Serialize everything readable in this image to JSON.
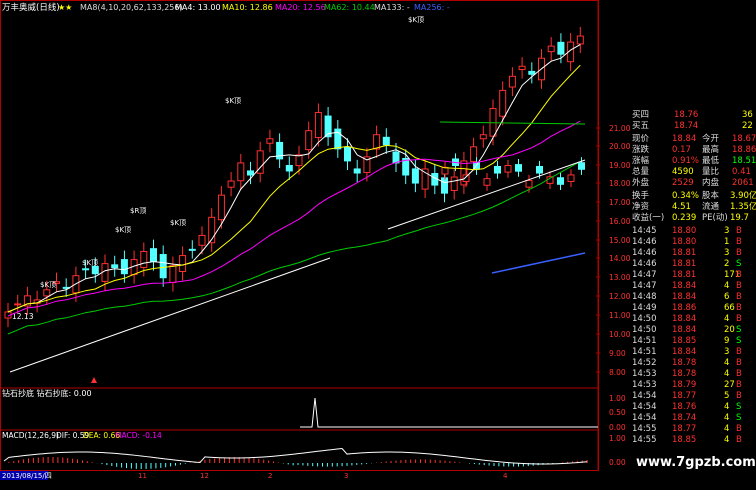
{
  "header": {
    "title": "万丰奥威(日线)",
    "stars": "★★",
    "ma_title": "MA8(4,10,20,62,133,256)",
    "ma4": "MA4: 13.00",
    "ma10": "MA10: 12.86",
    "ma20": "MA20: 12.56",
    "ma62": "MA62: 10.44",
    "ma133": "MA133: -",
    "ma256": "MA256: -"
  },
  "indicator_title": "钻石抄底 钻石抄底: 0.00",
  "macd_title": {
    "name": "MACD(12,26,9)",
    "dif": "DIF: 0.59",
    "dea": "DEA: 0.66",
    "macd": "MACD: -0.14"
  },
  "price_axis": [
    "21.00",
    "20.00",
    "19.00",
    "18.00",
    "17.00",
    "16.00",
    "15.00",
    "14.00",
    "13.00",
    "12.00",
    "11.00",
    "10.00",
    "9.00",
    "8.00"
  ],
  "ind_axis": [
    "1.00",
    "0.50",
    "0.00"
  ],
  "macd_axis": [
    "1.00",
    "0.00"
  ],
  "low_label": "12.13",
  "marks": [
    "$K顶",
    "$R顶",
    "$K顶",
    "$K顶",
    "$K顶",
    "$K顶",
    "$K顶"
  ],
  "date_label": "2013/08/15/四",
  "xlabels": [
    "11",
    "12",
    "2",
    "3",
    "4"
  ],
  "quote": {
    "rows": [
      {
        "l": "买四",
        "v": "18.76",
        "v2": "36",
        "c": "#ff3030"
      },
      {
        "l": "买五",
        "v": "18.74",
        "v2": "22",
        "c": "#ff3030"
      }
    ],
    "stats": [
      {
        "l": "现价",
        "v": "18.84",
        "l2": "今开",
        "v2": "18.67"
      },
      {
        "l": "涨跌",
        "v": "0.17",
        "l2": "最高",
        "v2": "18.86"
      },
      {
        "l": "涨幅",
        "v": "0.91%",
        "l2": "最低",
        "v2": "18.51"
      },
      {
        "l": "总量",
        "v": "4590",
        "l2": "量比",
        "v2": "0.41"
      },
      {
        "l": "外盘",
        "v": "2529",
        "l2": "内盘",
        "v2": "2061"
      }
    ],
    "stats2": [
      {
        "l": "换手",
        "v": "0.34%",
        "l2": "股本",
        "v2": "3.90亿"
      },
      {
        "l": "净资",
        "v": "4.51",
        "l2": "流通",
        "v2": "1.35亿"
      },
      {
        "l": "收益(一)",
        "v": "0.239",
        "l2": "PE(动)",
        "v2": "19.7"
      }
    ],
    "ticks": [
      {
        "t": "14:45",
        "p": "18.80",
        "q": "3",
        "d": "B"
      },
      {
        "t": "14:46",
        "p": "18.80",
        "q": "1",
        "d": "B"
      },
      {
        "t": "14:46",
        "p": "18.81",
        "q": "3",
        "d": "B"
      },
      {
        "t": "14:46",
        "p": "18.81",
        "q": "2",
        "d": "S"
      },
      {
        "t": "14:47",
        "p": "18.81",
        "q": "171",
        "d": "B"
      },
      {
        "t": "14:47",
        "p": "18.84",
        "q": "4",
        "d": "B"
      },
      {
        "t": "14:48",
        "p": "18.84",
        "q": "6",
        "d": "B"
      },
      {
        "t": "14:49",
        "p": "18.86",
        "q": "66",
        "d": "B"
      },
      {
        "t": "14:50",
        "p": "18.84",
        "q": "4",
        "d": "B"
      },
      {
        "t": "14:50",
        "p": "18.84",
        "q": "20",
        "d": "S"
      },
      {
        "t": "14:51",
        "p": "18.85",
        "q": "9",
        "d": "S"
      },
      {
        "t": "14:51",
        "p": "18.84",
        "q": "3",
        "d": "B"
      },
      {
        "t": "14:52",
        "p": "18.78",
        "q": "4",
        "d": "B"
      },
      {
        "t": "14:53",
        "p": "18.78",
        "q": "4",
        "d": "B"
      },
      {
        "t": "14:53",
        "p": "18.79",
        "q": "27",
        "d": "B"
      },
      {
        "t": "14:54",
        "p": "18.77",
        "q": "5",
        "d": "B"
      },
      {
        "t": "14:54",
        "p": "18.76",
        "q": "4",
        "d": "S"
      },
      {
        "t": "14:54",
        "p": "18.74",
        "q": "4",
        "d": "S"
      },
      {
        "t": "14:55",
        "p": "18.77",
        "q": "4",
        "d": "B"
      },
      {
        "t": "14:55",
        "p": "18.85",
        "q": "4",
        "d": "B"
      }
    ]
  },
  "watermark": "www.7gpzb.com",
  "colors": {
    "up": "#ff3030",
    "down": "#54ffff",
    "ma4": "#ffffff",
    "ma10": "#ffff00",
    "ma20": "#ff00ff",
    "ma62": "#00cc00",
    "ma133": "#ffffff",
    "ma256": "#3a5fff",
    "axis": "#b00000"
  }
}
